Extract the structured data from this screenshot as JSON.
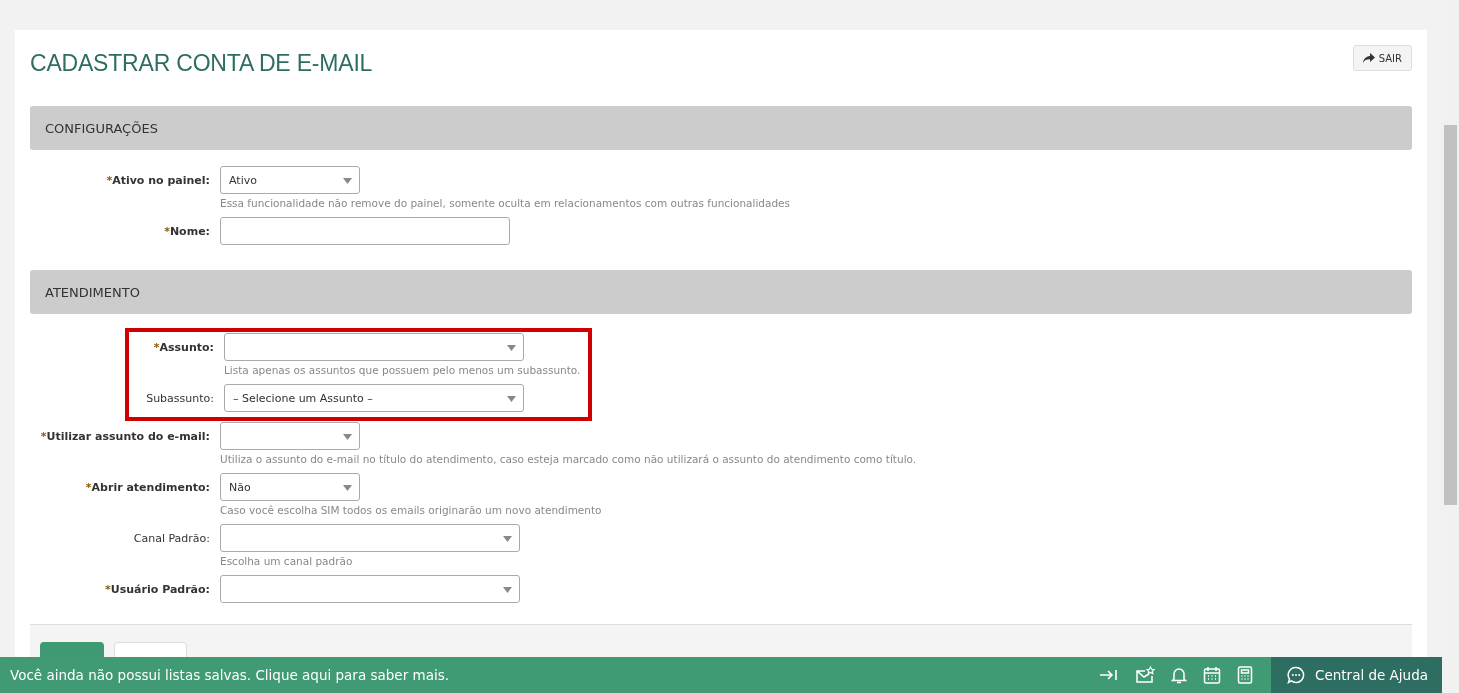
{
  "page": {
    "title": "CADASTRAR CONTA DE E-MAIL",
    "exit_button": "SAIR"
  },
  "sections": [
    {
      "title": "CONFIGURAÇÕES",
      "rows": [
        {
          "kind": "select-short",
          "marker": "*",
          "label": "Ativo no painel:",
          "value": "Ativo",
          "hint": "Essa funcionalidade não remove do painel, somente oculta em relacionamentos com outras funcionalidades",
          "highlighted": false
        },
        {
          "kind": "text",
          "marker": "*",
          "label": "Nome:",
          "highlighted": false
        }
      ]
    },
    {
      "title": "ATENDIMENTO",
      "rows": [
        {
          "kind": "select-long",
          "marker": "*",
          "label": "Assunto:",
          "hint": "Lista apenas os assuntos que possuem pelo menos um subassunto.",
          "highlighted": true
        },
        {
          "kind": "select-long",
          "label": "Subassunto:",
          "value": "– Selecione um Assunto –",
          "highlighted": true
        },
        {
          "kind": "select-short",
          "marker": "*",
          "label": "Utilizar assunto do e-mail:",
          "hint": "Utiliza o assunto do e-mail no título do atendimento, caso esteja marcado como não utilizará o assunto do atendimento como título.",
          "highlighted": false
        },
        {
          "kind": "select-short",
          "marker": "*",
          "label": "Abrir atendimento:",
          "value": "Não",
          "hint": "Caso você escolha SIM todos os emails originarão um novo atendimento",
          "highlighted": false
        },
        {
          "kind": "select-long",
          "label": "Canal Padrão:",
          "hint": "Escolha um canal padrão",
          "highlighted": false
        },
        {
          "kind": "select-long",
          "marker": "*",
          "label": "Usuário Padrão:",
          "highlighted": false
        }
      ]
    }
  ],
  "bottom_bar": {
    "message": "Você ainda não possui listas salvas. Clique aqui para saber mais.",
    "help": "Central de Ajuda"
  }
}
